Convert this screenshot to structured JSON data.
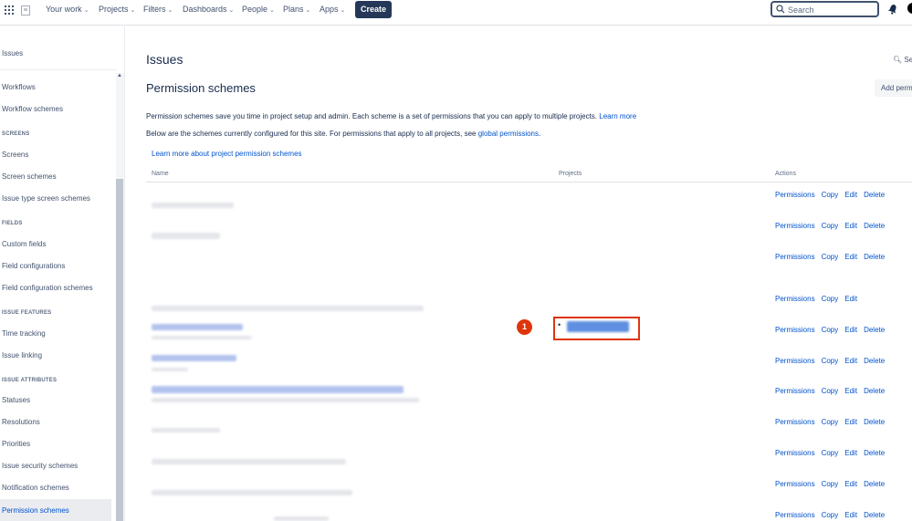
{
  "topnav": {
    "items": [
      {
        "label": "Your work"
      },
      {
        "label": "Projects"
      },
      {
        "label": "Filters"
      },
      {
        "label": "Dashboards"
      },
      {
        "label": "People"
      },
      {
        "label": "Plans"
      },
      {
        "label": "Apps"
      }
    ],
    "create_label": "Create",
    "search_placeholder": "Search"
  },
  "sidebar": {
    "title": "Issues",
    "entries": [
      {
        "type": "item",
        "label": "Workflows"
      },
      {
        "type": "item",
        "label": "Workflow schemes"
      },
      {
        "type": "heading",
        "label": "SCREENS"
      },
      {
        "type": "item",
        "label": "Screens"
      },
      {
        "type": "item",
        "label": "Screen schemes"
      },
      {
        "type": "item",
        "label": "Issue type screen schemes"
      },
      {
        "type": "heading",
        "label": "FIELDS"
      },
      {
        "type": "item",
        "label": "Custom fields"
      },
      {
        "type": "item",
        "label": "Field configurations"
      },
      {
        "type": "item",
        "label": "Field configuration schemes"
      },
      {
        "type": "heading",
        "label": "ISSUE FEATURES"
      },
      {
        "type": "item",
        "label": "Time tracking"
      },
      {
        "type": "item",
        "label": "Issue linking"
      },
      {
        "type": "heading",
        "label": "ISSUE ATTRIBUTES"
      },
      {
        "type": "item",
        "label": "Statuses"
      },
      {
        "type": "item",
        "label": "Resolutions"
      },
      {
        "type": "item",
        "label": "Priorities"
      },
      {
        "type": "item",
        "label": "Issue security schemes"
      },
      {
        "type": "item",
        "label": "Notification schemes"
      },
      {
        "type": "item",
        "label": "Permission schemes",
        "active": true
      }
    ]
  },
  "main": {
    "title": "Issues",
    "search_label": "Sea",
    "subtitle": "Permission schemes",
    "add_button": "Add perm",
    "desc1_text": "Permission schemes save you time in project setup and admin. Each scheme is a set of permissions that you can apply to multiple projects.",
    "desc1_link": "Learn more",
    "desc2_text": "Below are the schemes currently configured for this site. For permissions that apply to all projects, see",
    "desc2_link": "global permissions",
    "desc2_end": ".",
    "learn_more_link": "Learn more about project permission schemes",
    "columns": {
      "name": "Name",
      "projects": "Projects",
      "actions": "Actions"
    },
    "actions": {
      "permissions": "Permissions",
      "copy": "Copy",
      "edit": "Edit",
      "delete": "Delete"
    },
    "rows": [
      {
        "has_delete": true
      },
      {
        "has_delete": true
      },
      {
        "has_delete": true
      },
      {
        "has_delete": false
      },
      {
        "has_delete": true,
        "has_project": true
      },
      {
        "has_delete": true
      },
      {
        "has_delete": true
      },
      {
        "has_delete": true
      },
      {
        "has_delete": true
      },
      {
        "has_delete": true
      },
      {
        "has_delete": true
      }
    ],
    "marker_number": "1"
  }
}
